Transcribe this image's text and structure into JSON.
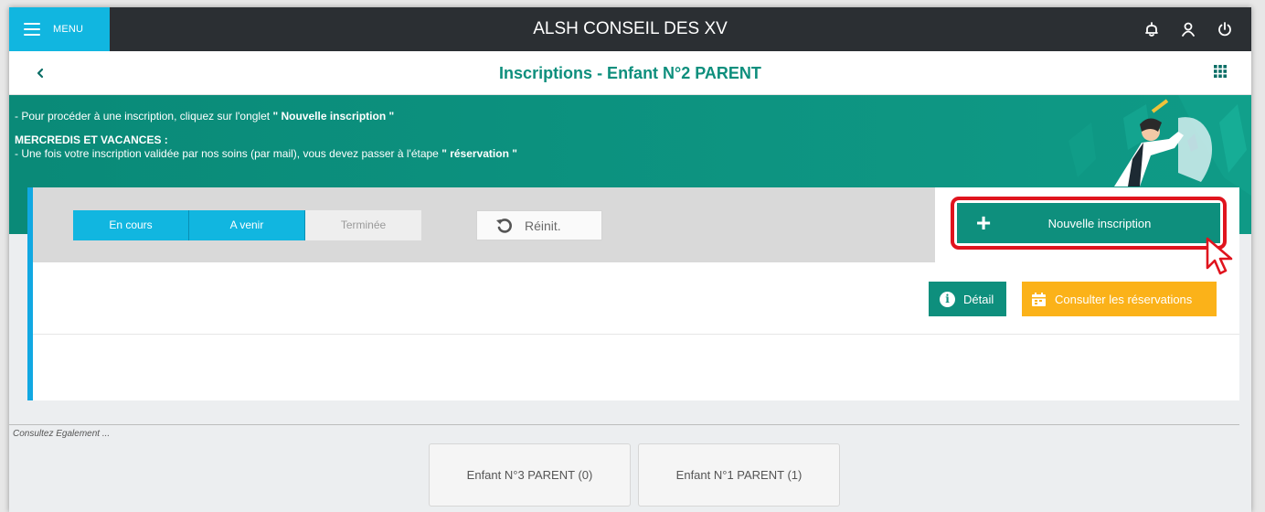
{
  "header": {
    "menu_label": "MENU",
    "app_title": "ALSH CONSEIL DES XV",
    "icons": [
      "bell-icon",
      "user-icon",
      "power-icon"
    ]
  },
  "page": {
    "title": "Inscriptions  -  Enfant N°2 PARENT"
  },
  "banner": {
    "line1_prefix": "- Pour procéder à une inscription, cliquez sur l'onglet ",
    "line1_bold": "\" Nouvelle inscription \"",
    "heading": "MERCREDIS ET VACANCES :",
    "line2_prefix": "- Une fois votre inscription validée par nos soins (par mail), vous devez passer à l'étape ",
    "line2_bold": "\" réservation \""
  },
  "filters": {
    "tabs": [
      {
        "label": "En cours",
        "active": true
      },
      {
        "label": "A venir",
        "active": true
      },
      {
        "label": "Terminée",
        "active": false
      }
    ],
    "reset_label": "Réinit."
  },
  "actions": {
    "new_label": "Nouvelle inscription",
    "detail_label": "Détail",
    "reservations_label": "Consulter les réservations"
  },
  "footer": {
    "see_also": "Consultez Egalement ...",
    "siblings": [
      "Enfant N°3 PARENT (0)",
      "Enfant N°1 PARENT (1)"
    ]
  },
  "colors": {
    "accent_blue": "#11b6e0",
    "brand_green": "#0e8f7d",
    "warning_orange": "#fbb219",
    "highlight_red": "#e0141e"
  }
}
